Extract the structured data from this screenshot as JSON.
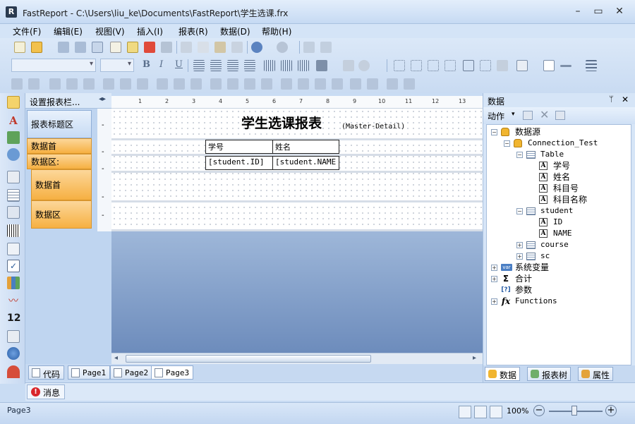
{
  "window": {
    "title": "FastReport - C:\\Users\\liu_ke\\Documents\\FastReport\\学生选课.frx",
    "minimize": "–",
    "maximize": "▭",
    "close": "✕"
  },
  "menu": [
    "文件(F)",
    "编辑(E)",
    "视图(V)",
    "插入(I)",
    "报表(R)",
    "数据(D)",
    "帮助(H)"
  ],
  "band_panel": {
    "header": "设置报表栏...",
    "bands": [
      {
        "label": "报表标题区",
        "style": "blue"
      },
      {
        "label": "数据首",
        "style": "orange"
      },
      {
        "label": "数据区:",
        "style": "orange"
      },
      {
        "label": "数据首",
        "style": "orange"
      },
      {
        "label": "数据区",
        "style": "orange"
      }
    ]
  },
  "ruler": {
    "labels": [
      "1",
      "2",
      "3",
      "4",
      "5",
      "6",
      "7",
      "8",
      "9",
      "10",
      "11",
      "12",
      "13"
    ]
  },
  "design": {
    "report_title": "学生选课报表",
    "title_suffix": "(Master-Detail)",
    "header_cells": [
      "学号",
      "姓名"
    ],
    "data_cells": [
      "[student.ID]",
      "[student.NAME"
    ]
  },
  "page_tabs": [
    {
      "label": "代码",
      "active": false
    },
    {
      "label": "Page1",
      "active": false
    },
    {
      "label": "Page2",
      "active": false
    },
    {
      "label": "Page3",
      "active": true
    }
  ],
  "messages": {
    "label": "消息"
  },
  "status": {
    "text": "Page3",
    "zoom": "100%"
  },
  "data_panel": {
    "title": "数据",
    "pin": "ᛘ",
    "close": "✕",
    "action_label": "动作",
    "tree": [
      {
        "label": "数据源",
        "icon": "database-icon",
        "level": 0,
        "exp": "−"
      },
      {
        "label": "Connection_Test",
        "icon": "database-icon",
        "level": 1,
        "exp": "−"
      },
      {
        "label": "Table",
        "icon": "table-icon",
        "level": 2,
        "exp": "−"
      },
      {
        "label": "学号",
        "icon": "field-icon",
        "level": 3,
        "exp": ""
      },
      {
        "label": "姓名",
        "icon": "field-icon",
        "level": 3,
        "exp": ""
      },
      {
        "label": "科目号",
        "icon": "field-icon",
        "level": 3,
        "exp": ""
      },
      {
        "label": "科目名称",
        "icon": "field-icon",
        "level": 3,
        "exp": ""
      },
      {
        "label": "student",
        "icon": "table-icon",
        "level": 2,
        "exp": "−"
      },
      {
        "label": "ID",
        "icon": "field-icon",
        "level": 3,
        "exp": ""
      },
      {
        "label": "NAME",
        "icon": "field-icon",
        "level": 3,
        "exp": ""
      },
      {
        "label": "course",
        "icon": "table-icon",
        "level": 2,
        "exp": "+"
      },
      {
        "label": "sc",
        "icon": "table-icon",
        "level": 2,
        "exp": "+"
      },
      {
        "label": "系统变量",
        "icon": "variable-icon",
        "level": 0,
        "exp": "+"
      },
      {
        "label": "合计",
        "icon": "sum-icon",
        "level": 0,
        "exp": "+"
      },
      {
        "label": "参数",
        "icon": "parameter-icon",
        "level": 0,
        "exp": ""
      },
      {
        "label": "Functions",
        "icon": "function-icon",
        "level": 0,
        "exp": "+"
      }
    ],
    "tabs": [
      {
        "label": "数据",
        "active": true
      },
      {
        "label": "报表树",
        "active": false
      },
      {
        "label": "属性",
        "active": false
      }
    ]
  }
}
